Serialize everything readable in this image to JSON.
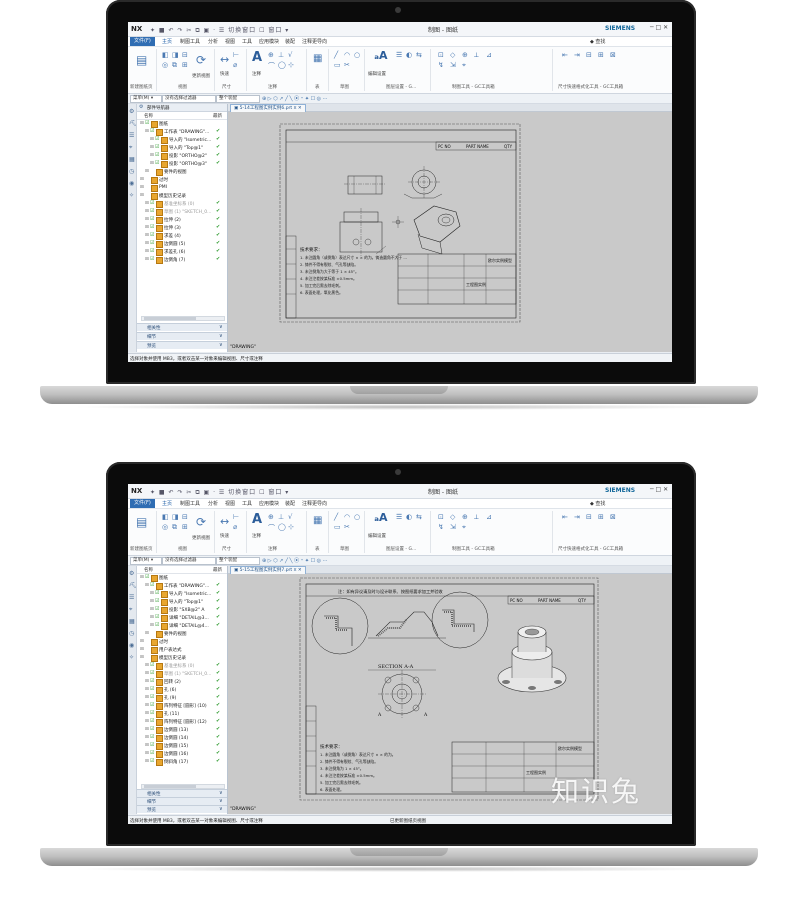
{
  "app": {
    "logo": "NX",
    "quick_access": "✦ ■ ↶ ↷ ✂ ⧉ ▣ · ☰ 切换窗口 ☐ 窗口 ▾",
    "title": "制图 - 图纸",
    "brand": "SIEMENS",
    "window_controls": "─ □ ✕"
  },
  "menu": {
    "file": "文件(F)",
    "tabs": [
      "主页",
      "制图工具",
      "分析",
      "视图",
      "工具",
      "应用模块",
      "装配",
      "注释更导向"
    ],
    "command_finder": "◆ 查找"
  },
  "ribbon": {
    "new_sheet": "新建图纸页",
    "view": "视图",
    "update_view": "更新视图",
    "quick": "快速",
    "dimension": "尺寸",
    "annotation": "注释",
    "note": "注释",
    "table": "表",
    "sketch": "草图",
    "edit_settings": "编辑设置",
    "layer_settings": "图层设置 - G...",
    "drafting_tools": "制图工具 - GC工具箱",
    "dim_tools": "尺寸快速格式化工具 - GC工具箱"
  },
  "selection_bar": {
    "menu": "菜单(M) ▾",
    "filter": "没有选择过滤器",
    "assembly": "整个装配",
    "tools": "⊕ ▷ ⬡ ↗ ╱ ╲ ⦿ ⁃ ✦ ☐ ◎ ⋯"
  },
  "resource_icons": [
    "⚙",
    "⛏",
    "☰",
    "⌖",
    "▦",
    "◷",
    "◉",
    "✧"
  ],
  "screen1": {
    "navigator_title": "部件导航器",
    "col_name": "名称",
    "col_new": "最新",
    "tree": [
      {
        "text": "图纸",
        "indent": 1,
        "check": true,
        "latest": false,
        "grey": false
      },
      {
        "text": "工作表 \"DRAWING\"...",
        "indent": 2,
        "check": true,
        "latest": true,
        "grey": false
      },
      {
        "text": "导入的 \"Isometric...",
        "indent": 3,
        "check": true,
        "latest": true,
        "grey": false
      },
      {
        "text": "导入的 \"Top@1\"",
        "indent": 3,
        "check": true,
        "latest": true,
        "grey": false
      },
      {
        "text": "投影 \"ORTHO@2\"",
        "indent": 3,
        "check": true,
        "latest": true,
        "grey": false
      },
      {
        "text": "投影 \"ORTHO@3\"",
        "indent": 3,
        "check": true,
        "latest": true,
        "grey": false
      },
      {
        "text": "要件的视图",
        "indent": 2,
        "check": false,
        "latest": false,
        "grey": false
      },
      {
        "text": "过时",
        "indent": 1,
        "check": false,
        "latest": false,
        "grey": false
      },
      {
        "text": "PMI",
        "indent": 1,
        "check": false,
        "latest": false,
        "grey": false
      },
      {
        "text": "模型历史记录",
        "indent": 1,
        "check": false,
        "latest": false,
        "grey": false
      },
      {
        "text": "基准坐标系 (0)",
        "indent": 2,
        "check": true,
        "latest": true,
        "grey": true
      },
      {
        "text": "草图 (1) \"SKETCH_0...",
        "indent": 2,
        "check": true,
        "latest": true,
        "grey": true
      },
      {
        "text": "拉伸 (2)",
        "indent": 2,
        "check": true,
        "latest": true,
        "grey": false
      },
      {
        "text": "拉伸 (3)",
        "indent": 2,
        "check": true,
        "latest": true,
        "grey": false
      },
      {
        "text": "求差 (4)",
        "indent": 2,
        "check": true,
        "latest": true,
        "grey": false
      },
      {
        "text": "边倒圆 (5)",
        "indent": 2,
        "check": true,
        "latest": true,
        "grey": false
      },
      {
        "text": "求差孔 (6)",
        "indent": 2,
        "check": true,
        "latest": true,
        "grey": false
      },
      {
        "text": "边倒角 (7)",
        "indent": 2,
        "check": true,
        "latest": true,
        "grey": false
      }
    ],
    "panels": [
      "相关性",
      "细节",
      "预览"
    ],
    "tab_title": "▣ 5-14工程图实例实例6.prt ¤ ✕",
    "sheet_label": "\"DRAWING\"",
    "status": "选择对象并使用 MB3，或者双击某一对象来编辑视图、尺寸或注释",
    "status_right": "",
    "notes_title": "技术要求：",
    "notes": [
      "1. 未注圆角（或倒角）表达尺寸 × × 的为。铸造圆角不大于 ...",
      "2. 铸件不得有裂纹、气孔等缺陷。",
      "3. 未注倒角为大于等于 1 × 45°。",
      "4. 未注涳差按某标准 ±0.5mm。",
      "5. 加工完后需去除毛刺。",
      "6. 表面处理，氧化黑色。"
    ],
    "title_block": {
      "pc_no": "PC NO",
      "part_name": "PART NAME",
      "qty": "QTY",
      "drawing_name": "工程图实例",
      "company": "欧尔实例模型"
    }
  },
  "screen2": {
    "navigator_title": "",
    "col_name": "名称",
    "col_new": "最新",
    "tree": [
      {
        "text": "图纸",
        "indent": 1,
        "check": true,
        "latest": false,
        "grey": false
      },
      {
        "text": "工作表 \"DRAWING\"...",
        "indent": 2,
        "check": true,
        "latest": true,
        "grey": false
      },
      {
        "text": "导入的 \"Isometric...",
        "indent": 3,
        "check": true,
        "latest": true,
        "grey": false
      },
      {
        "text": "导入的 \"Top@1\"",
        "indent": 3,
        "check": true,
        "latest": true,
        "grey": false
      },
      {
        "text": "投影 \"SXB@2\" A",
        "indent": 3,
        "check": true,
        "latest": true,
        "grey": false
      },
      {
        "text": "详细 \"DETAIL@3...",
        "indent": 3,
        "check": true,
        "latest": true,
        "grey": false
      },
      {
        "text": "详细 \"DETAIL@4...",
        "indent": 3,
        "check": true,
        "latest": true,
        "grey": false
      },
      {
        "text": "要件的视图",
        "indent": 2,
        "check": false,
        "latest": false,
        "grey": false
      },
      {
        "text": "过时",
        "indent": 1,
        "check": false,
        "latest": false,
        "grey": false
      },
      {
        "text": "用户表达式",
        "indent": 1,
        "check": false,
        "latest": false,
        "grey": false
      },
      {
        "text": "模型历史记录",
        "indent": 1,
        "check": false,
        "latest": false,
        "grey": false
      },
      {
        "text": "基准坐标系 (0)",
        "indent": 2,
        "check": true,
        "latest": true,
        "grey": true
      },
      {
        "text": "草图 (1) \"SKETCH_0...",
        "indent": 2,
        "check": true,
        "latest": true,
        "grey": true
      },
      {
        "text": "回转 (2)",
        "indent": 2,
        "check": true,
        "latest": true,
        "grey": false
      },
      {
        "text": "孔 (6)",
        "indent": 2,
        "check": true,
        "latest": true,
        "grey": false
      },
      {
        "text": "孔 (9)",
        "indent": 2,
        "check": true,
        "latest": true,
        "grey": false
      },
      {
        "text": "阵列特征 [圆形] (10)",
        "indent": 2,
        "check": true,
        "latest": true,
        "grey": false
      },
      {
        "text": "孔 (11)",
        "indent": 2,
        "check": true,
        "latest": true,
        "grey": false
      },
      {
        "text": "阵列特征 [圆形] (12)",
        "indent": 2,
        "check": true,
        "latest": true,
        "grey": false
      },
      {
        "text": "边倒圆 (13)",
        "indent": 2,
        "check": true,
        "latest": true,
        "grey": false
      },
      {
        "text": "边倒圆 (14)",
        "indent": 2,
        "check": true,
        "latest": true,
        "grey": false
      },
      {
        "text": "边倒圆 (15)",
        "indent": 2,
        "check": true,
        "latest": true,
        "grey": false
      },
      {
        "text": "边倒圆 (16)",
        "indent": 2,
        "check": true,
        "latest": true,
        "grey": false
      },
      {
        "text": "倒斜角 (17)",
        "indent": 2,
        "check": true,
        "latest": true,
        "grey": false
      }
    ],
    "panels": [
      "相关性",
      "细节",
      "预览"
    ],
    "tab_title": "▣ 5-15工程图实例实例7.prt ¤ ✕",
    "sheet_label": "\"DRAWING\"",
    "status": "选择对象并使用 MB3，或者双击某一对象来编辑视图、尺寸或注释",
    "status_right": "已更新图纸页视图",
    "section_label": "SECTION A-A",
    "section_letter": "A",
    "header_note": "注：如有异议请及时与设计联系、按图纸要求加工并验收",
    "notes_title": "技术要求：",
    "notes": [
      "1. 未注圆角（或倒角）表达尺寸 × × 的为。",
      "2. 铸件不得有裂纹、气孔等缺陷。",
      "3. 未注倒角为 1 × 45°。",
      "4. 未注涳差按某标准 ±0.5mm。",
      "5. 加工完后需去除毛刺。",
      "6. 表面处理。"
    ],
    "title_block": {
      "pc_no": "PC NO",
      "part_name": "PART NAME",
      "qty": "QTY",
      "drawing_name": "工程图实例",
      "company": "欧尔实例模型"
    }
  },
  "watermark": "知识兔",
  "colors": {
    "accent": "#2f6db3",
    "check": "#2d9a2d",
    "canvas": "#c9c9c9",
    "drawing_line": "#222222"
  }
}
